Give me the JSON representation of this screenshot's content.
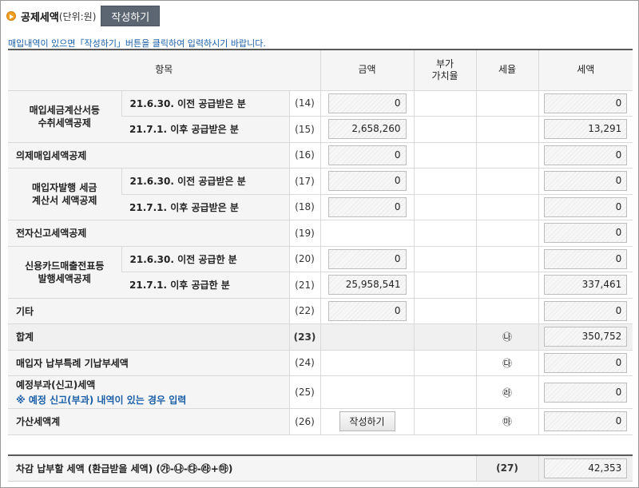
{
  "header": {
    "title": "공제세액",
    "unit": "(단위:원)",
    "write_button": "작성하기"
  },
  "notice": "매입내역이 있으면「작성하기」버튼을 클릭하여 입력하시기 바랍니다.",
  "columns": {
    "item": "항목",
    "amount": "금액",
    "rate_line1": "부가",
    "rate_line2": "가치율",
    "tax_rate": "세율",
    "tax": "세액"
  },
  "rows": {
    "g1": {
      "label_line1": "매입세금계산서등",
      "label_line2": "수취세액공제"
    },
    "r14": {
      "sub": "21.6.30. 이전 공급받은 분",
      "code": "(14)",
      "amount": "0",
      "tax": "0"
    },
    "r15": {
      "sub": "21.7.1. 이후 공급받은 분",
      "code": "(15)",
      "amount": "2,658,260",
      "tax": "13,291"
    },
    "r16": {
      "label": "의제매입세액공제",
      "code": "(16)",
      "amount": "0",
      "tax": "0"
    },
    "g2": {
      "label_line1": "매입자발행 세금",
      "label_line2": "계산서 세액공제"
    },
    "r17": {
      "sub": "21.6.30. 이전 공급받은 분",
      "code": "(17)",
      "amount": "0",
      "tax": "0"
    },
    "r18": {
      "sub": "21.7.1. 이후 공급받은 분",
      "code": "(18)",
      "amount": "0",
      "tax": "0"
    },
    "r19": {
      "label": "전자신고세액공제",
      "code": "(19)",
      "tax": "0"
    },
    "g3": {
      "label_line1": "신용카드매출전표등",
      "label_line2": "발행세액공제"
    },
    "r20": {
      "sub": "21.6.30. 이전 공급한 분",
      "code": "(20)",
      "amount": "0",
      "tax": "0"
    },
    "r21": {
      "sub": "21.7.1. 이후 공급한 분",
      "code": "(21)",
      "amount": "25,958,541",
      "tax": "337,461"
    },
    "r22": {
      "label": "기타",
      "code": "(22)",
      "amount": "0",
      "tax": "0"
    },
    "r23": {
      "label": "합계",
      "code": "(23)",
      "mark": "㉯",
      "tax": "350,752"
    },
    "r24": {
      "label": "매입자 납부특례 기납부세액",
      "code": "(24)",
      "mark": "㉰",
      "tax": "0"
    },
    "r25": {
      "label": "예정부과(신고)세액",
      "note": "※ 예정 신고(부과) 내역이 있는 경우 입력",
      "code": "(25)",
      "mark": "㉱",
      "tax": "0"
    },
    "r26": {
      "label": "가산세액계",
      "code": "(26)",
      "button": "작성하기",
      "mark": "㉲",
      "tax": "0"
    }
  },
  "final": {
    "label": "차감 납부할 세액 (환급받을 세액) (㉮-㉯-㉰-㉱+㉲)",
    "code": "(27)",
    "tax": "42,353"
  }
}
